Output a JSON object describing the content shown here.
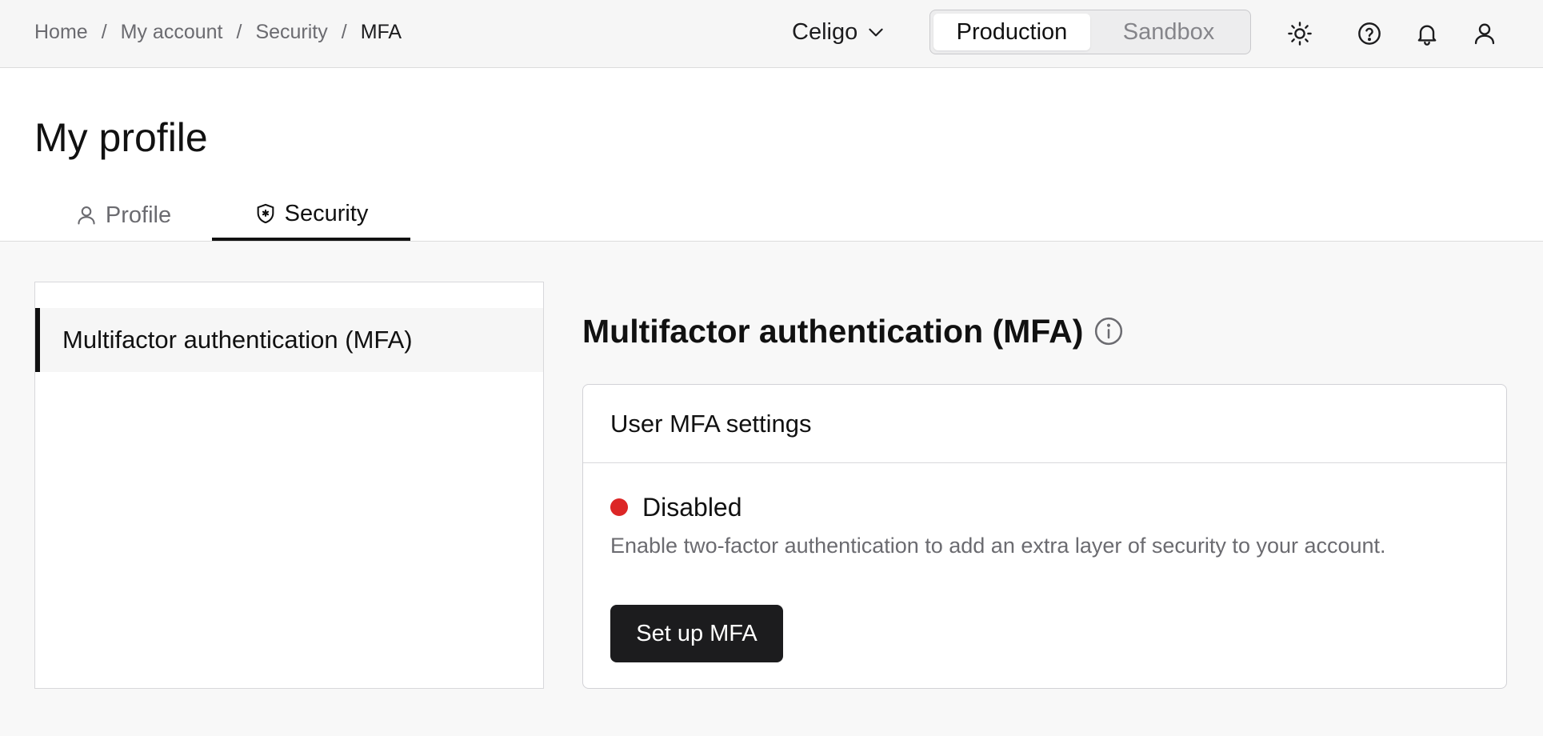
{
  "breadcrumb": {
    "items": [
      "Home",
      "My account",
      "Security",
      "MFA"
    ],
    "separator": "/"
  },
  "org_selector": {
    "label": "Celigo",
    "icon": "chevron-down-icon"
  },
  "environment": {
    "options": [
      "Production",
      "Sandbox"
    ],
    "selected": "Production"
  },
  "top_icons": [
    "sun-icon",
    "help-icon",
    "bell-icon",
    "user-icon"
  ],
  "page_title": "My profile",
  "tabs": [
    {
      "label": "Profile",
      "icon": "user-icon",
      "active": false
    },
    {
      "label": "Security",
      "icon": "shield-icon",
      "active": true
    }
  ],
  "side_nav": {
    "items": [
      {
        "label": "Multifactor authentication (MFA)",
        "active": true
      }
    ]
  },
  "section": {
    "title": "Multifactor authentication (MFA)",
    "info_icon": "info-icon"
  },
  "card": {
    "title": "User MFA settings",
    "status": "Disabled",
    "status_color": "#dc2626",
    "description": "Enable two-factor authentication to add an extra layer of security to your account.",
    "button_label": "Set up MFA"
  },
  "colors": {
    "primary_button": "#1c1c1e",
    "muted_text": "#6b6b70",
    "background": "#f8f8f8"
  }
}
